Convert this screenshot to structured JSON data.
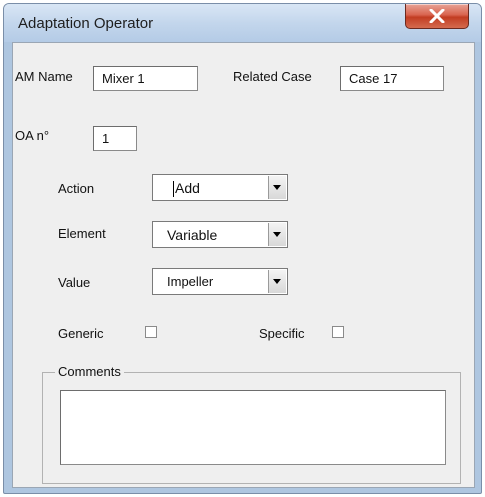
{
  "window": {
    "title": "Adaptation Operator",
    "close_symbol": "×",
    "close_icon": "close-icon"
  },
  "form": {
    "am_name": {
      "label": "AM Name",
      "value": "Mixer 1"
    },
    "related_case": {
      "label": "Related Case",
      "value": "Case 17"
    },
    "oa_number": {
      "label": "OA n°",
      "value": "1"
    },
    "action": {
      "label": "Action",
      "value": "Add",
      "icon": "chevron-down-icon"
    },
    "element": {
      "label": "Element",
      "value": "Variable",
      "icon": "chevron-down-icon"
    },
    "value": {
      "label": "Value",
      "value": "Impeller",
      "icon": "chevron-down-icon"
    },
    "generic": {
      "label": "Generic",
      "checked": false
    },
    "specific": {
      "label": "Specific",
      "checked": false
    },
    "comments": {
      "label": "Comments",
      "value": ""
    }
  },
  "colors": {
    "close_button": "#c94a2e",
    "dialog_background": "#efefef",
    "title_bar": "#c3d6ec"
  }
}
